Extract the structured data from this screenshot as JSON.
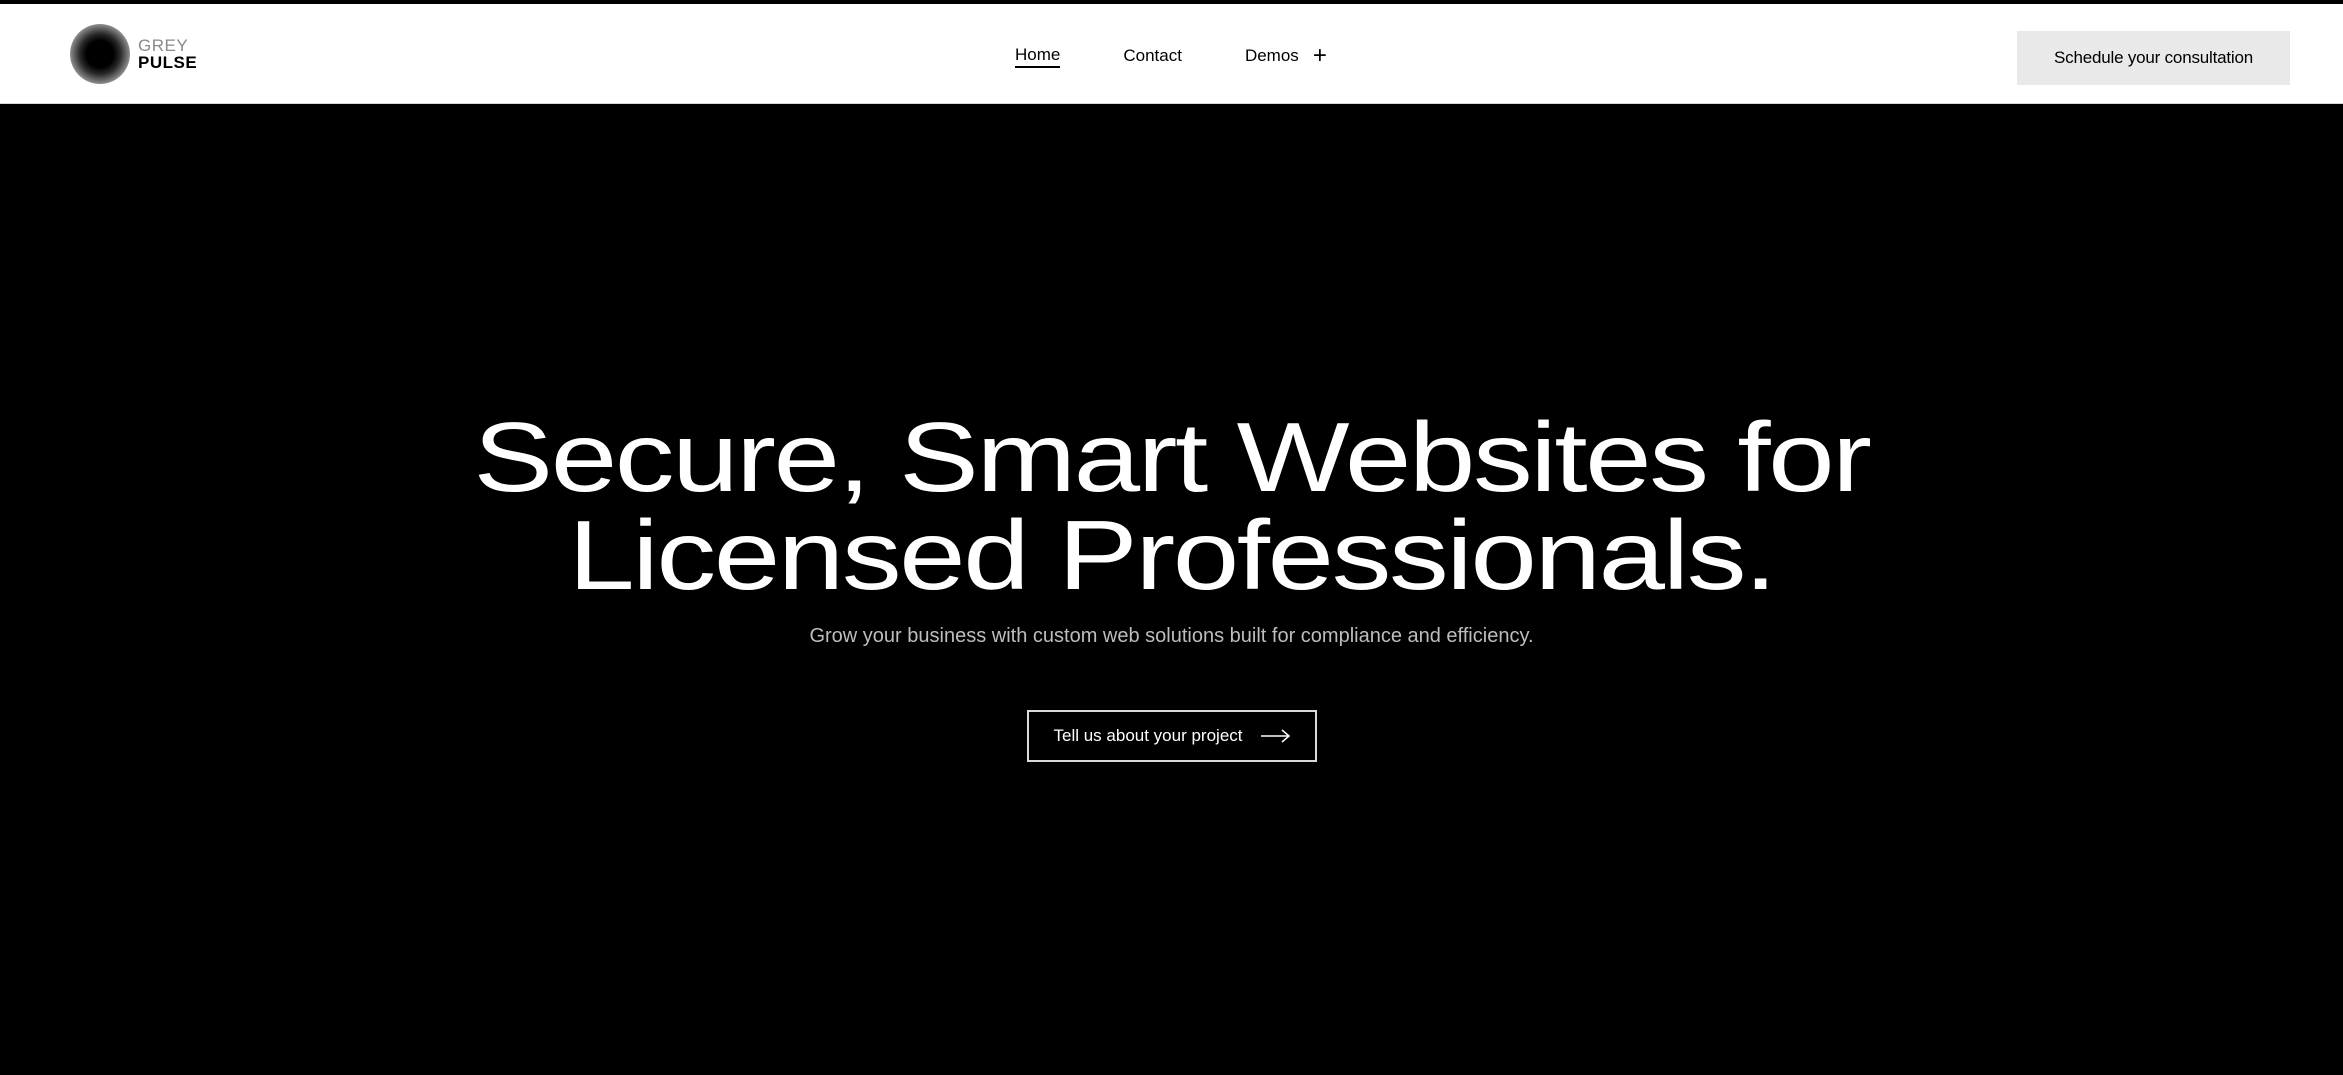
{
  "brand": {
    "line1": "GREY",
    "line2": "PULSE",
    "icon": "gradient-orb-logo"
  },
  "nav": {
    "items": [
      {
        "label": "Home",
        "active": true
      },
      {
        "label": "Contact",
        "active": false
      },
      {
        "label": "Demos",
        "active": false,
        "icon": "plus-icon"
      }
    ]
  },
  "header": {
    "cta_label": "Schedule your consultation"
  },
  "hero": {
    "title_line1": "Secure, Smart Websites for",
    "title_line2": "Licensed Professionals.",
    "subtitle": "Grow your business with custom web solutions built for compliance and efficiency.",
    "button_label": "Tell us about your project",
    "button_icon": "arrow-right-icon"
  },
  "colors": {
    "header_bg": "#ffffff",
    "hero_bg": "#000000",
    "cta_bg": "#e9e9e9",
    "text_light": "#ffffff",
    "text_muted": "#bdbdbd"
  }
}
